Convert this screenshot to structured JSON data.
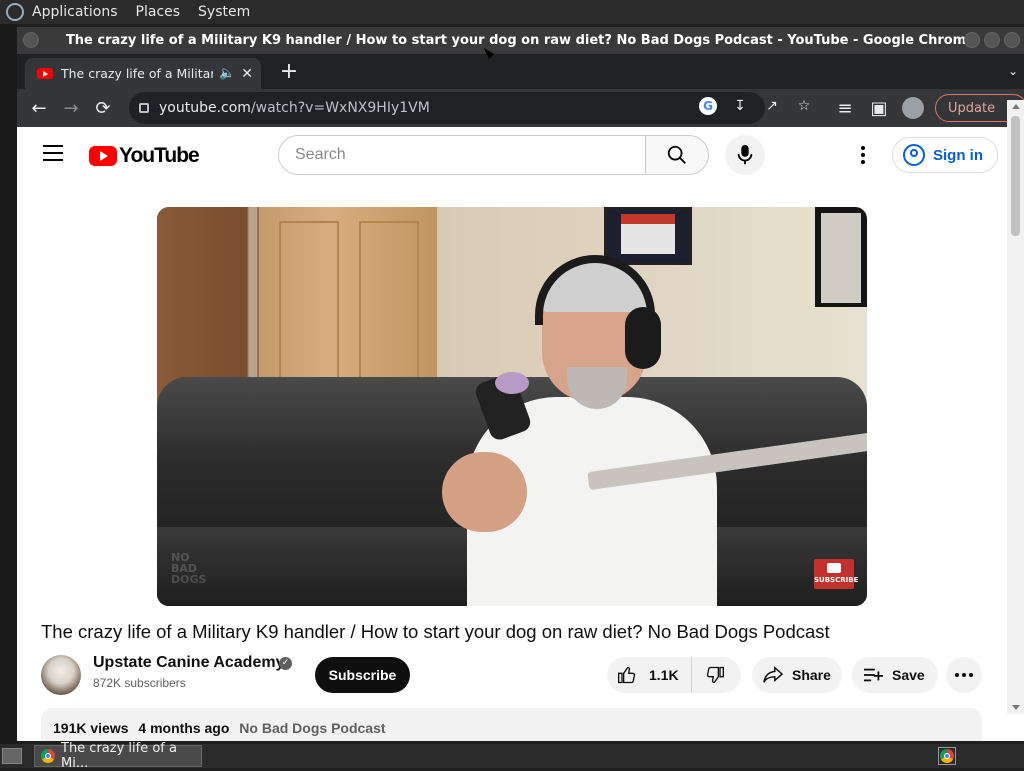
{
  "desktop": {
    "menus": [
      "Applications",
      "Places",
      "System"
    ]
  },
  "window": {
    "title": "The crazy life of a Military K9 handler / How to start your dog on raw diet? No Bad Dogs Podcast - YouTube - Google Chrome"
  },
  "browser": {
    "tab_title": "The crazy life of a Military K",
    "new_tab_label": "+",
    "url_host": "youtube.com",
    "url_path": "/watch?v=WxNX9HIy1VM",
    "update_label": "Update",
    "icons": [
      "back-icon",
      "forward-icon",
      "reload-icon",
      "lock-icon",
      "google-icon",
      "install-icon",
      "share-icon",
      "bookmark-star-icon",
      "reading-list-icon",
      "side-panel-icon",
      "profile-icon",
      "kebab-menu-icon"
    ]
  },
  "youtube": {
    "logo_text": "YouTube",
    "search_placeholder": "Search",
    "sign_in_label": "Sign in",
    "video_title": "The crazy life of a Military K9 handler / How to start your dog on raw diet? No Bad Dogs Podcast",
    "channel_name": "Upstate Canine Academy",
    "subscribers": "872K subscribers",
    "subscribe_label": "Subscribe",
    "likes": "1.1K",
    "share_label": "Share",
    "save_label": "Save",
    "views": "191K views",
    "uploaded": "4 months ago",
    "podcast_link": "No Bad Dogs Podcast",
    "watermark_text": "NO BAD DOGS",
    "badge_text": "SUBSCRIBE"
  },
  "taskbar": {
    "item_label": "The crazy life of a Mi..."
  },
  "colors": {
    "youtube_red": "#ff0000",
    "link_blue": "#065fd4",
    "update_accent": "#e37263"
  }
}
